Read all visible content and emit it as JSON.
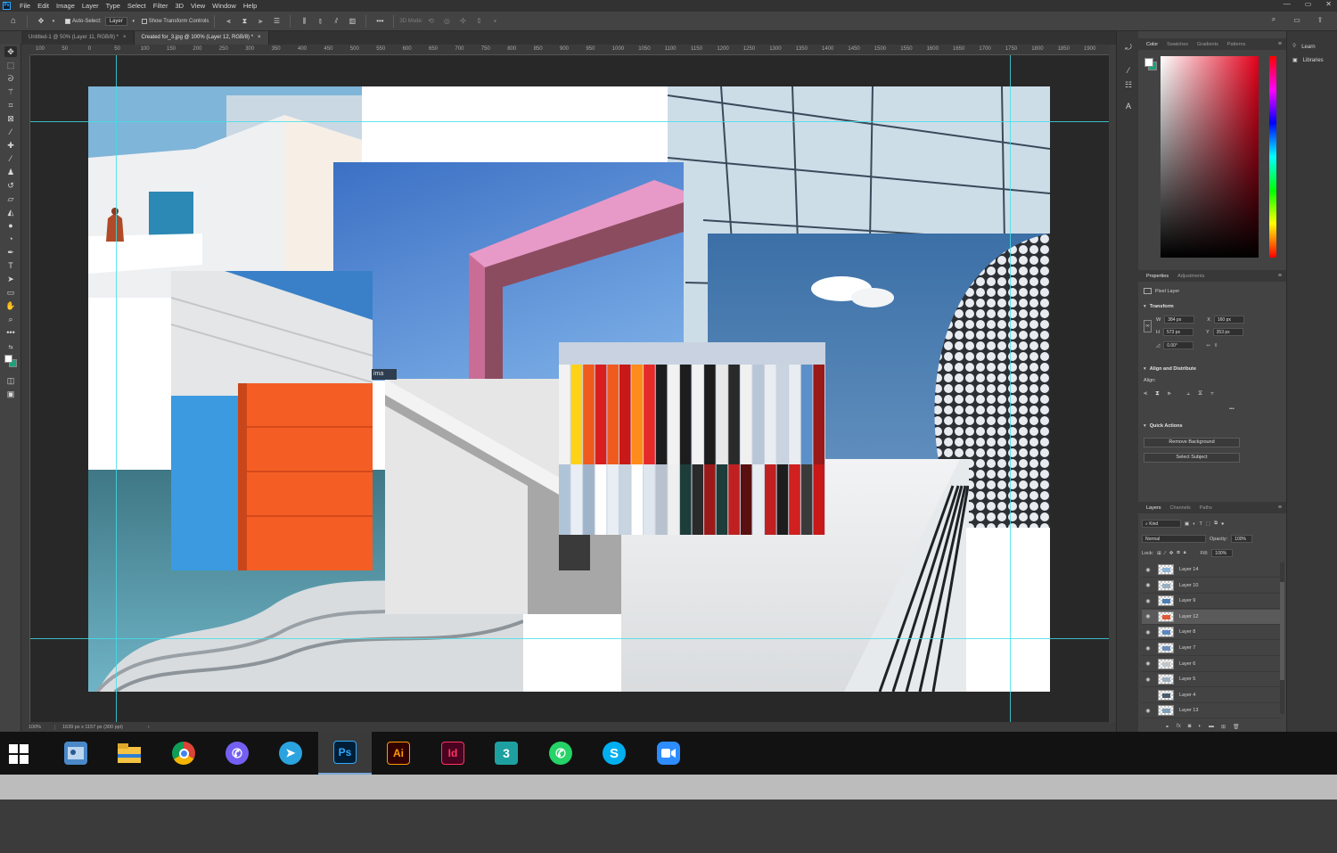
{
  "menubar": {
    "items": [
      "File",
      "Edit",
      "Image",
      "Layer",
      "Type",
      "Select",
      "Filter",
      "3D",
      "View",
      "Window",
      "Help"
    ],
    "window_controls": [
      "—",
      "▭",
      "✕"
    ]
  },
  "optionsbar": {
    "auto_select_label": "Auto-Select:",
    "auto_select_value": "Layer",
    "show_transform_label": "Show Transform Controls",
    "mode_label": "3D Mode:"
  },
  "tabs": [
    {
      "label": "Untitled-1 @ 50% (Layer 11, RGB/8) *",
      "active": false
    },
    {
      "label": "Created for_3.jpg @ 100% (Layer 12, RGB/8) *",
      "active": true
    }
  ],
  "ruler_ticks": [
    "100",
    "50",
    "0",
    "50",
    "100",
    "150",
    "200",
    "250",
    "300",
    "350",
    "400",
    "450",
    "500",
    "550",
    "600",
    "650",
    "700",
    "750",
    "800",
    "850",
    "900",
    "950",
    "1000",
    "1050",
    "1100",
    "1150",
    "1200",
    "1250",
    "1300",
    "1350",
    "1400",
    "1450",
    "1500",
    "1550",
    "1600",
    "1650",
    "1700",
    "1750",
    "1800",
    "1850",
    "1900"
  ],
  "canvas": {
    "partial_text": "ima"
  },
  "statusbar": {
    "zoom": "100%",
    "doc_info": "1639 px x 1157 px (300 ppi)",
    "arrow": "›"
  },
  "color_panel": {
    "tabs": [
      "Color",
      "Swatches",
      "Gradients",
      "Patterns"
    ],
    "foreground": "#ffffff",
    "background": "#1aa27c"
  },
  "far_right": {
    "learn": "Learn",
    "libraries": "Libraries"
  },
  "properties": {
    "tabs": [
      "Properties",
      "Adjustments"
    ],
    "layer_type": "Pixel Layer",
    "transform_title": "Transform",
    "w_label": "W",
    "w_value": "384 px",
    "x_label": "X",
    "x_value": "160 px",
    "h_label": "H",
    "h_value": "573 px",
    "y_label": "Y",
    "y_value": "353 px",
    "angle_value": "0.00°",
    "align_title": "Align and Distribute",
    "align_label": "Align:",
    "more": "•••",
    "quick_actions_title": "Quick Actions",
    "remove_bg": "Remove Background",
    "select_subject": "Select Subject"
  },
  "layers": {
    "tabs": [
      "Layers",
      "Channels",
      "Paths"
    ],
    "filter_kind": "Kind",
    "blend_mode": "Normal",
    "opacity_label": "Opacity:",
    "opacity_value": "100%",
    "lock_label": "Lock:",
    "fill_label": "Fill:",
    "fill_value": "100%",
    "items": [
      {
        "name": "Layer 14",
        "visible": true,
        "selected": false
      },
      {
        "name": "Layer 10",
        "visible": true,
        "selected": false
      },
      {
        "name": "Layer 9",
        "visible": true,
        "selected": false
      },
      {
        "name": "Layer 12",
        "visible": true,
        "selected": true
      },
      {
        "name": "Layer 8",
        "visible": true,
        "selected": false
      },
      {
        "name": "Layer 7",
        "visible": true,
        "selected": false
      },
      {
        "name": "Layer 6",
        "visible": true,
        "selected": false
      },
      {
        "name": "Layer 5",
        "visible": true,
        "selected": false
      },
      {
        "name": "Layer 4",
        "visible": false,
        "selected": false
      },
      {
        "name": "Layer 13",
        "visible": true,
        "selected": false
      }
    ]
  },
  "taskbar": {
    "apps": [
      {
        "name": "File Explorer (user)",
        "icon": "contacts-icon"
      },
      {
        "name": "File Explorer",
        "icon": "folder-icon"
      },
      {
        "name": "Chrome",
        "icon": "chrome-icon"
      },
      {
        "name": "Viber",
        "icon": "viber-icon"
      },
      {
        "name": "Telegram",
        "icon": "telegram-icon"
      },
      {
        "name": "Photoshop",
        "icon_text": "Ps"
      },
      {
        "name": "Illustrator",
        "icon_text": "Ai"
      },
      {
        "name": "InDesign",
        "icon_text": "Id"
      },
      {
        "name": "3ds Max",
        "icon_text": "3"
      },
      {
        "name": "WhatsApp",
        "icon": "whatsapp-icon"
      },
      {
        "name": "Skype",
        "icon_text": "S"
      },
      {
        "name": "Zoom",
        "icon": "zoom-icon"
      }
    ]
  }
}
